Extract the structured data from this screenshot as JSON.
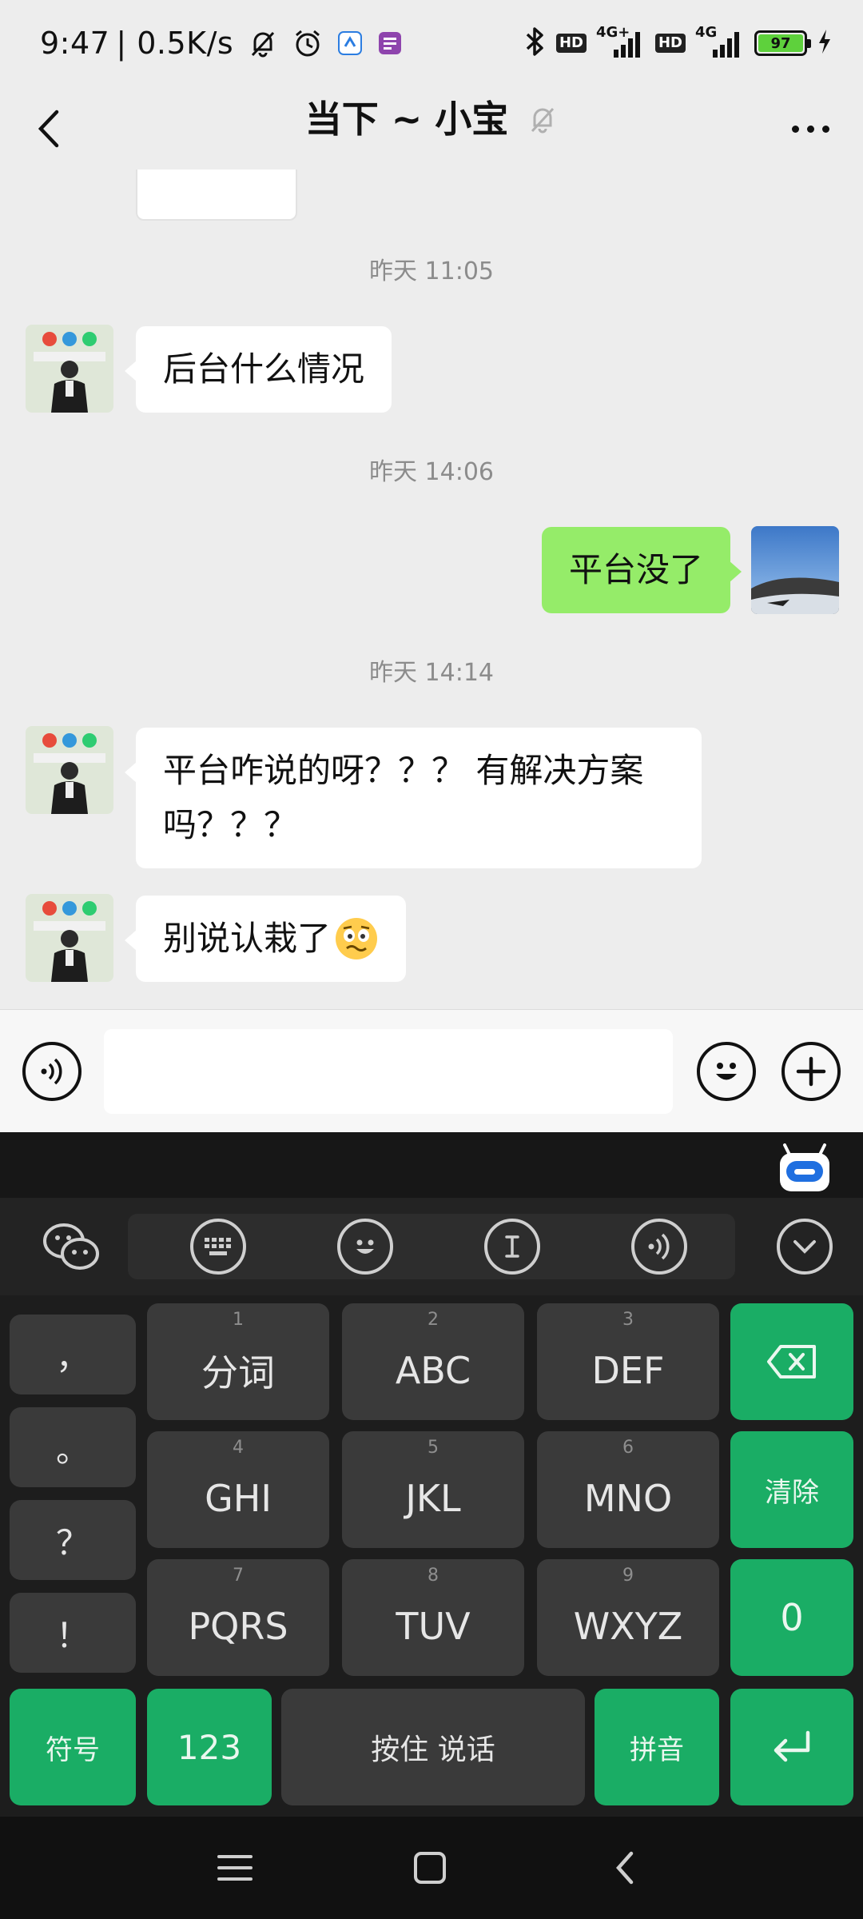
{
  "status_bar": {
    "time": "9:47",
    "speed": "| 0.5K/s",
    "hd1": "HD",
    "net1": "4G+",
    "hd2": "HD",
    "net2": "4G",
    "battery": "97"
  },
  "header": {
    "title": "当下 ~ 小宝"
  },
  "messages": [
    {
      "type": "time",
      "text": "昨天 11:05"
    },
    {
      "type": "received",
      "text": "后台什么情况"
    },
    {
      "type": "time",
      "text": "昨天 14:06"
    },
    {
      "type": "sent",
      "text": "平台没了"
    },
    {
      "type": "time",
      "text": "昨天 14:14"
    },
    {
      "type": "received",
      "line1": "平台咋说的呀？？？ 有解决方案",
      "line2": "吗？？？"
    },
    {
      "type": "received",
      "text": "别说认栽了",
      "emoji": "🥴"
    }
  ],
  "input": {
    "placeholder": ""
  },
  "keyboard": {
    "punctuation": [
      "，",
      "。",
      "？",
      "！"
    ],
    "rows": [
      [
        {
          "num": "1",
          "label": "分词"
        },
        {
          "num": "2",
          "label": "ABC"
        },
        {
          "num": "3",
          "label": "DEF"
        }
      ],
      [
        {
          "num": "4",
          "label": "GHI"
        },
        {
          "num": "5",
          "label": "JKL"
        },
        {
          "num": "6",
          "label": "MNO"
        }
      ],
      [
        {
          "num": "7",
          "label": "PQRS"
        },
        {
          "num": "8",
          "label": "TUV"
        },
        {
          "num": "9",
          "label": "WXYZ"
        }
      ]
    ],
    "clear": "清除",
    "zero": "0",
    "symbols": "符号",
    "num_mode": "123",
    "space": "按住 说话",
    "pinyin": "拼音"
  },
  "colors": {
    "sent_bubble": "#95ec69",
    "keyboard_green": "#1aad65",
    "chat_bg": "#ededed"
  }
}
